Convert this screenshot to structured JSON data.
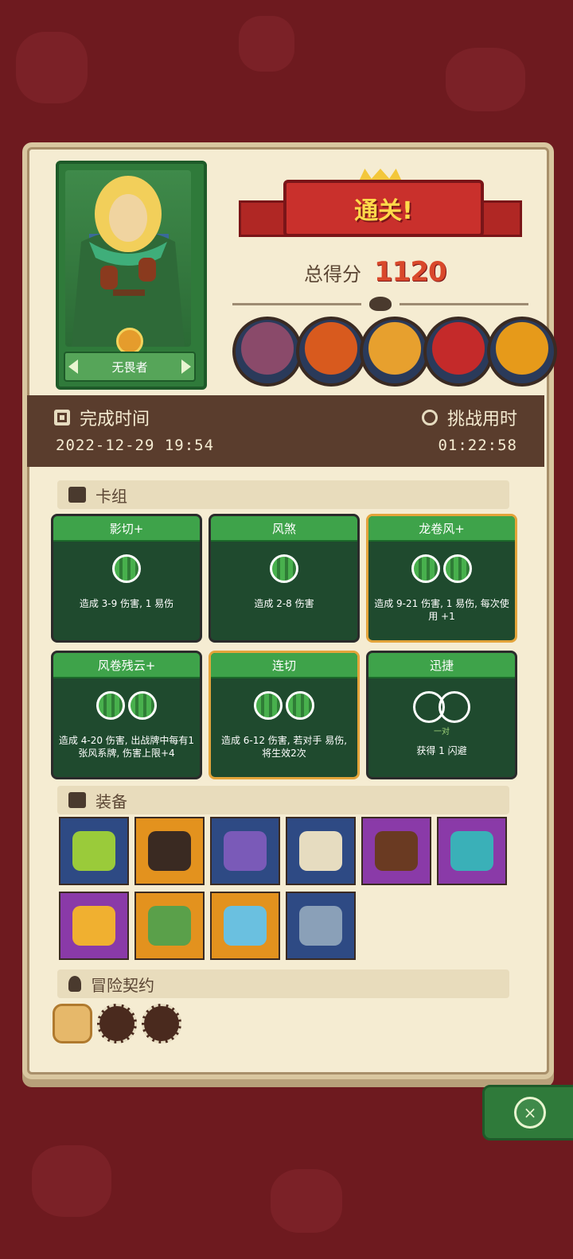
{
  "hero": {
    "name": "无畏者"
  },
  "banner": {
    "title": "通关!"
  },
  "score": {
    "label": "总得分",
    "value": "1120"
  },
  "bosses": [
    {
      "color": "#8a4a6a"
    },
    {
      "color": "#d85a1e"
    },
    {
      "color": "#e7a02e"
    },
    {
      "color": "#c42a2a"
    },
    {
      "color": "#e69a1a"
    }
  ],
  "stats": {
    "finish_label": "完成时间",
    "finish_value": "2022-12-29 19:54",
    "duration_label": "挑战用时",
    "duration_value": "01:22:58"
  },
  "sections": {
    "deck": "卡组",
    "equipment": "装备",
    "contracts": "冒险契约"
  },
  "cards": [
    {
      "title": "影切+",
      "orbs": 1,
      "desc": "造成 3-9 伤害, 1 易伤",
      "gold": false
    },
    {
      "title": "风煞",
      "orbs": 1,
      "desc": "造成 2-8 伤害",
      "gold": false
    },
    {
      "title": "龙卷风+",
      "orbs": 2,
      "desc": "造成 9-21 伤害, 1 易伤, 每次使用 +1",
      "gold": true
    },
    {
      "title": "风卷残云+",
      "orbs": 2,
      "desc": "造成 4-20 伤害, 出战牌中每有1张风系牌, 伤害上限+4",
      "gold": false
    },
    {
      "title": "连切",
      "orbs": 2,
      "desc": "造成 6-12 伤害, 若对手 易伤, 将生效2次",
      "gold": true
    },
    {
      "title": "迅捷",
      "orbs": 0,
      "sub": "一对",
      "desc": "获得 1 闪避",
      "gold": false
    }
  ],
  "equipment": [
    {
      "bg": "blue",
      "icon": "#9acb3a"
    },
    {
      "bg": "orange",
      "icon": "#3a2a22"
    },
    {
      "bg": "blue",
      "icon": "#7a5ab8"
    },
    {
      "bg": "blue",
      "icon": "#e6dcc0"
    },
    {
      "bg": "purple",
      "icon": "#6a3a22"
    },
    {
      "bg": "purple",
      "icon": "#3ab0b8"
    },
    {
      "bg": "purple",
      "icon": "#f0b030"
    },
    {
      "bg": "orange",
      "icon": "#5aa04a"
    },
    {
      "bg": "orange",
      "icon": "#6ac0e0"
    },
    {
      "bg": "blue",
      "icon": "#8aa0b8"
    }
  ],
  "close": {
    "label": "×"
  }
}
